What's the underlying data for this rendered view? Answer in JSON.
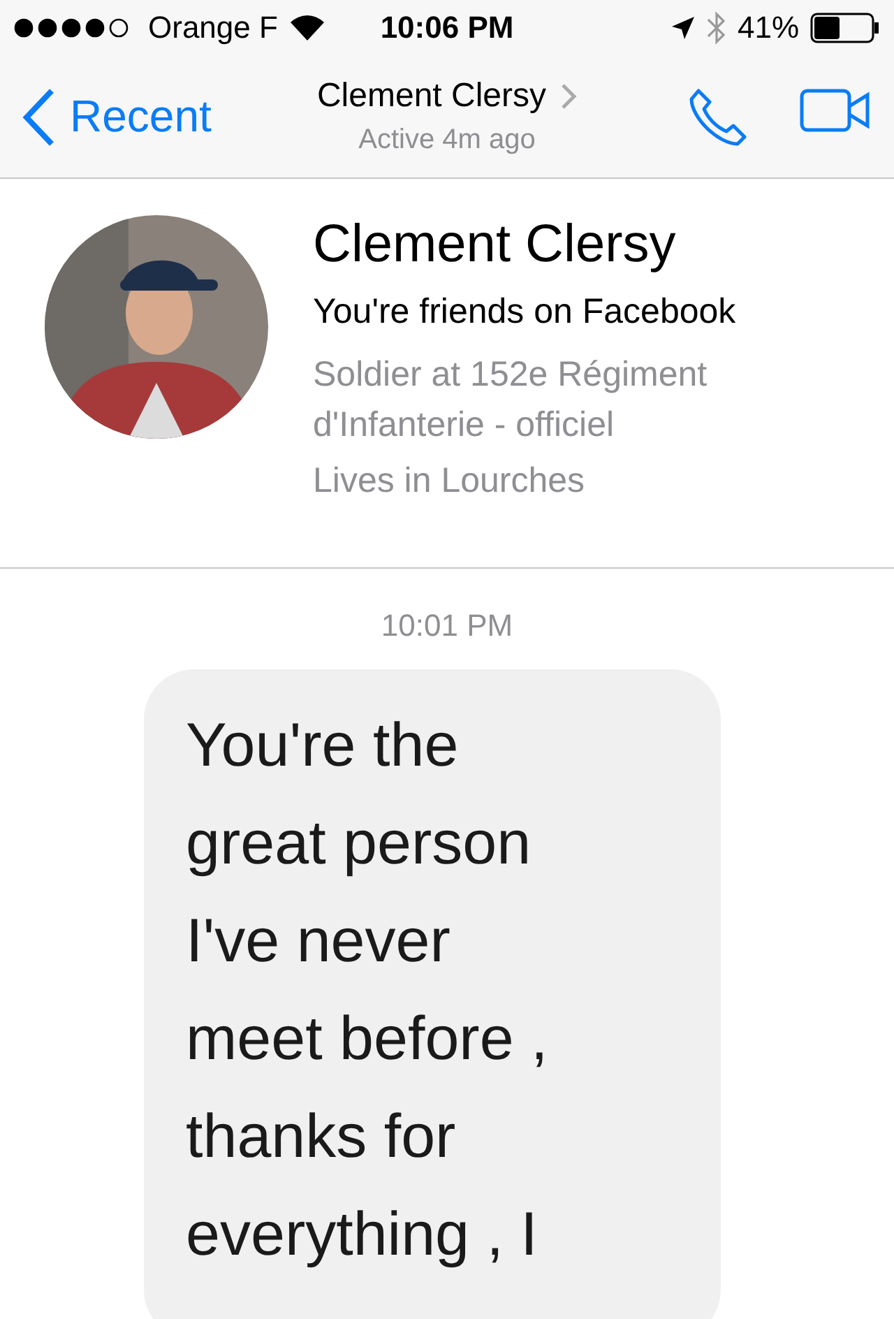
{
  "status_bar": {
    "carrier": "Orange F",
    "time": "10:06 PM",
    "battery": "41%"
  },
  "nav": {
    "back": "Recent",
    "title": "Clement Clersy",
    "subtitle": "Active 4m ago"
  },
  "profile": {
    "name": "Clement Clersy",
    "relation": "You're friends on Facebook",
    "details": [
      "Soldier at 152e Régiment d'Infanterie - officiel",
      "Lives in Lourches"
    ]
  },
  "messages": [
    {
      "kind": "timestamp",
      "text": "10:01 PM"
    },
    {
      "kind": "received",
      "lines": [
        "You're the",
        "great person",
        "I've never",
        "meet before ,",
        "thanks for",
        "everything , I"
      ]
    }
  ]
}
